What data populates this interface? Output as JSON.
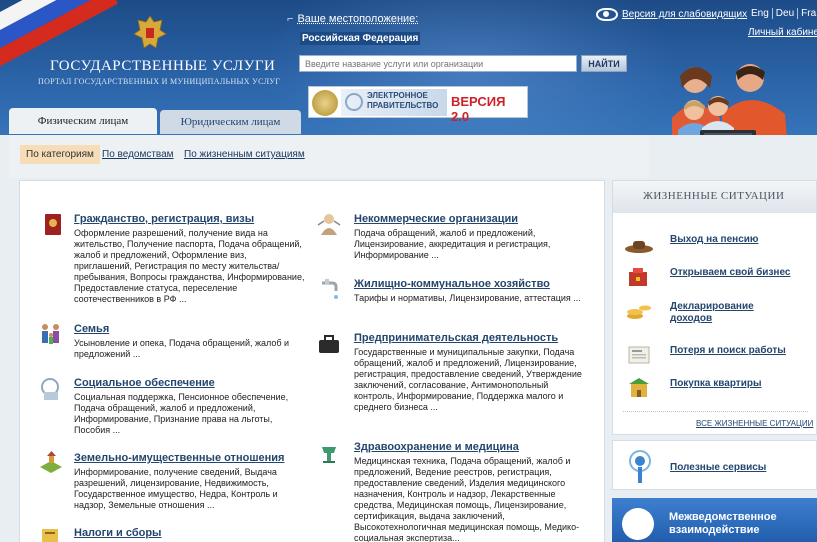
{
  "header": {
    "site_title": "ГОСУДАРСТВЕННЫЕ УСЛУГИ",
    "site_subtitle": "ПОРТАЛ ГОСУДАРСТВЕННЫХ И МУНИЦИПАЛЬНЫХ УСЛУГ",
    "location_label": "Ваше местоположение:",
    "location_value": "Российская Федерация",
    "search_placeholder": "Введите название услуги или организации",
    "search_button": "НАЙТИ",
    "egov_line1": "ЭЛЕКТРОННОЕ",
    "egov_line2": "ПРАВИТЕЛЬСТВО",
    "egov_version": "ВЕРСИЯ 2.0",
    "vision_link": "Версия для слабовидящих",
    "languages": [
      "Eng",
      "Deu",
      "Fra"
    ],
    "cabinet_link": "Личный кабинет"
  },
  "tabs": {
    "individuals": "Физическим лицам",
    "legal": "Юридическим лицам"
  },
  "subnav": {
    "by_category": "По категориям",
    "by_department": "По ведомствам",
    "by_life_situation": "По жизненным ситуациям"
  },
  "categories_left": [
    {
      "title": "Гражданство, регистрация, визы",
      "desc": "Оформление разрешений, получение вида на жительство, Получение паспорта, Подача обращений, жалоб и предложений, Оформление виз, приглашений, Регистрация по месту жительства/пребывания, Вопросы гражданства, Информирование, Предоставление статуса, переселение соотечественников в РФ ...",
      "icon": "passport-icon"
    },
    {
      "title": "Семья",
      "desc": "Усыновление и опека, Подача обращений, жалоб и предложений ...",
      "icon": "family-icon"
    },
    {
      "title": "Социальное обеспечение",
      "desc": "Социальная поддержка, Пенсионное обеспечение, Подача обращений, жалоб и предложений, Информирование, Признание права на льготы, Пособия ...",
      "icon": "social-support-icon"
    },
    {
      "title": "Земельно-имущественные отношения",
      "desc": "Информирование, получение сведений, Выдача разрешений, лицензирование, Недвижимость, Государственное имущество, Недра, Контроль и надзор, Земельные отношения ...",
      "icon": "land-icon"
    },
    {
      "title": "Налоги и сборы",
      "desc": "",
      "icon": "taxes-icon"
    }
  ],
  "categories_right": [
    {
      "title": "Некоммерческие организации",
      "desc": "Подача обращений, жалоб и предложений, Лицензирование, аккредитация и регистрация, Информирование ...",
      "icon": "nonprofit-icon"
    },
    {
      "title": "Жилищно-коммунальное хозяйство",
      "desc": "Тарифы и нормативы, Лицензирование, аттестация ...",
      "icon": "faucet-icon"
    },
    {
      "title": "Предпринимательская деятельность",
      "desc": "Государственные и муниципальные закупки, Подача обращений, жалоб и предложений, Лицензирование, регистрация, предоставление сведений, Утверждение заключений, согласование, Антимонопольный контроль, Информирование, Поддержка малого и среднего бизнеса ...",
      "icon": "briefcase-icon"
    },
    {
      "title": "Здравоохранение и медицина",
      "desc": "Медицинская техника, Подача обращений, жалоб и предложений, Ведение реестров, регистрация, предоставление сведений, Изделия медицинского назначения, Контроль и надзор, Лекарственные средства, Медицинская помощь, Лицензирование, сертификация, выдача заключений, Высокотехнологичная медицинская помощь, Медико-социальная экспертиза...",
      "icon": "medicine-icon"
    }
  ],
  "sidebar": {
    "heading": "ЖИЗНЕННЫЕ СИТУАЦИИ",
    "items": [
      {
        "label": "Выход на пенсию",
        "icon": "hat-icon"
      },
      {
        "label": "Открываем свой бизнес",
        "icon": "business-icon"
      },
      {
        "label": "Декларирование доходов",
        "icon": "coins-icon"
      },
      {
        "label": "Потеря и поиск работы",
        "icon": "newspaper-icon"
      },
      {
        "label": "Покупка квартиры",
        "icon": "apartment-icon"
      }
    ],
    "all_link": "ВСЕ ЖИЗНЕННЫЕ СИТУАЦИИ"
  },
  "services": {
    "label": "Полезные сервисы"
  },
  "interdep": {
    "label_line1": "Межведомственное",
    "label_line2": "взаимодействие"
  }
}
